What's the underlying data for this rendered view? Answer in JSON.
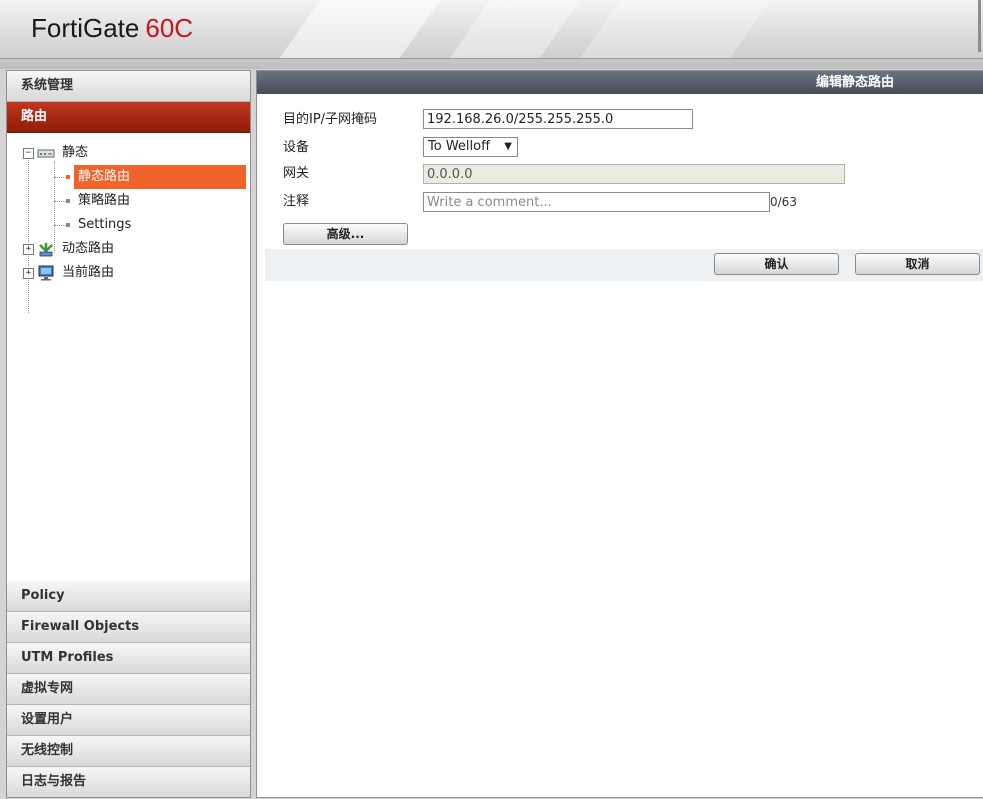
{
  "header": {
    "brand": "FortiGate",
    "model": "60C"
  },
  "sidebar": {
    "top_sections": [
      {
        "label": "系统管理"
      },
      {
        "label": "路由"
      }
    ],
    "tree": {
      "static": "静态",
      "static_route": "静态路由",
      "policy_route": "策略路由",
      "settings": "Settings",
      "dynamic_route": "动态路由",
      "current_route": "当前路由"
    },
    "bottom_sections": [
      {
        "label": "Policy"
      },
      {
        "label": "Firewall Objects"
      },
      {
        "label": "UTM Profiles"
      },
      {
        "label": "虚拟专网"
      },
      {
        "label": "设置用户"
      },
      {
        "label": "无线控制"
      },
      {
        "label": "日志与报告"
      }
    ]
  },
  "main": {
    "title": "编辑静态路由",
    "form": {
      "dest_label": "目的IP/子网掩码",
      "dest_value": "192.168.26.0/255.255.255.0",
      "device_label": "设备",
      "device_value": "To Welloff",
      "device_arrow": "▼",
      "gateway_label": "网关",
      "gateway_value": "0.0.0.0",
      "comment_label": "注释",
      "comment_placeholder": "Write a comment...",
      "comment_count": "0/63"
    },
    "advanced_button": "高级...",
    "ok_button": "确认",
    "cancel_button": "取消"
  },
  "colors": {
    "brand_red": "#c4161c",
    "active_nav": "#a52812",
    "selected_item": "#f0642c",
    "titlebar": "#4f5763"
  }
}
